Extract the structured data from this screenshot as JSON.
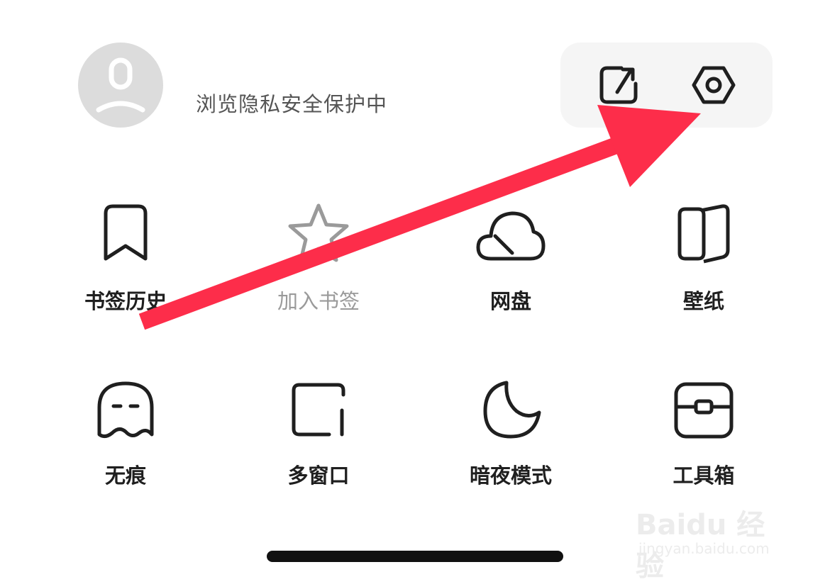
{
  "header": {
    "status_text": "浏览隐私安全保护中",
    "avatar_icon": "user-avatar-icon",
    "quick_actions": [
      {
        "name": "share-icon"
      },
      {
        "name": "settings-icon"
      }
    ]
  },
  "grid": {
    "row1": [
      {
        "label": "书签历史",
        "icon": "bookmark-icon"
      },
      {
        "label": "加入书签",
        "icon": "star-icon"
      },
      {
        "label": "网盘",
        "icon": "cloud-icon"
      },
      {
        "label": "壁纸",
        "icon": "wallpaper-icon"
      }
    ],
    "row2": [
      {
        "label": "无痕",
        "icon": "ghost-icon"
      },
      {
        "label": "多窗口",
        "icon": "multi-window-icon"
      },
      {
        "label": "暗夜模式",
        "icon": "moon-icon"
      },
      {
        "label": "工具箱",
        "icon": "toolbox-icon"
      }
    ]
  },
  "watermark": {
    "logo": "Baidu 经验",
    "url": "jingyan.baidu.com"
  },
  "colors": {
    "annotation_arrow": "#fd2d4a",
    "icon_stroke": "#1f1f1f",
    "dim_text": "#9a9a9a",
    "panel_bg": "#f5f5f5",
    "avatar_bg": "#dcdcdc"
  }
}
